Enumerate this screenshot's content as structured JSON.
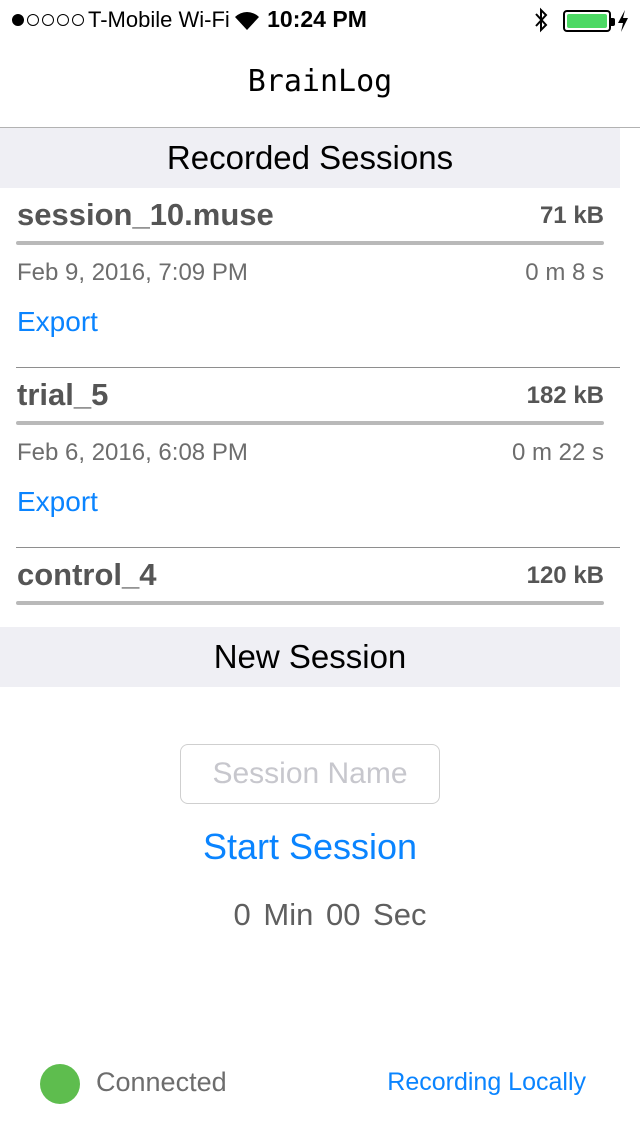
{
  "status_bar": {
    "carrier": "T-Mobile Wi-Fi",
    "time": "10:24 PM",
    "signal_bars_filled": 1,
    "signal_bars_total": 5,
    "battery_level": 1.0,
    "icons": [
      "wifi-icon",
      "bluetooth-icon",
      "battery-icon",
      "charging-bolt-icon"
    ]
  },
  "nav": {
    "title": "BrainLog"
  },
  "recorded_sessions": {
    "header": "Recorded Sessions",
    "items": [
      {
        "name": "session_10.muse",
        "size": "71 kB",
        "date": "Feb 9, 2016, 7:09 PM",
        "duration": "0 m 8 s",
        "action": "Export"
      },
      {
        "name": "trial_5",
        "size": "182 kB",
        "date": "Feb 6, 2016, 6:08 PM",
        "duration": "0 m 22 s",
        "action": "Export"
      },
      {
        "name": "control_4",
        "size": "120 kB"
      }
    ]
  },
  "new_session": {
    "header": "New Session",
    "name_placeholder": "Session Name",
    "name_value": "",
    "start_label": "Start Session",
    "timer": "0 Min  00 Sec"
  },
  "footer": {
    "connection_status": "Connected",
    "connection_color": "#5ebd4e",
    "recording_mode": "Recording Locally"
  },
  "colors": {
    "accent": "#0a84ff",
    "section_bg": "#efeff4",
    "battery": "#4cd964"
  }
}
